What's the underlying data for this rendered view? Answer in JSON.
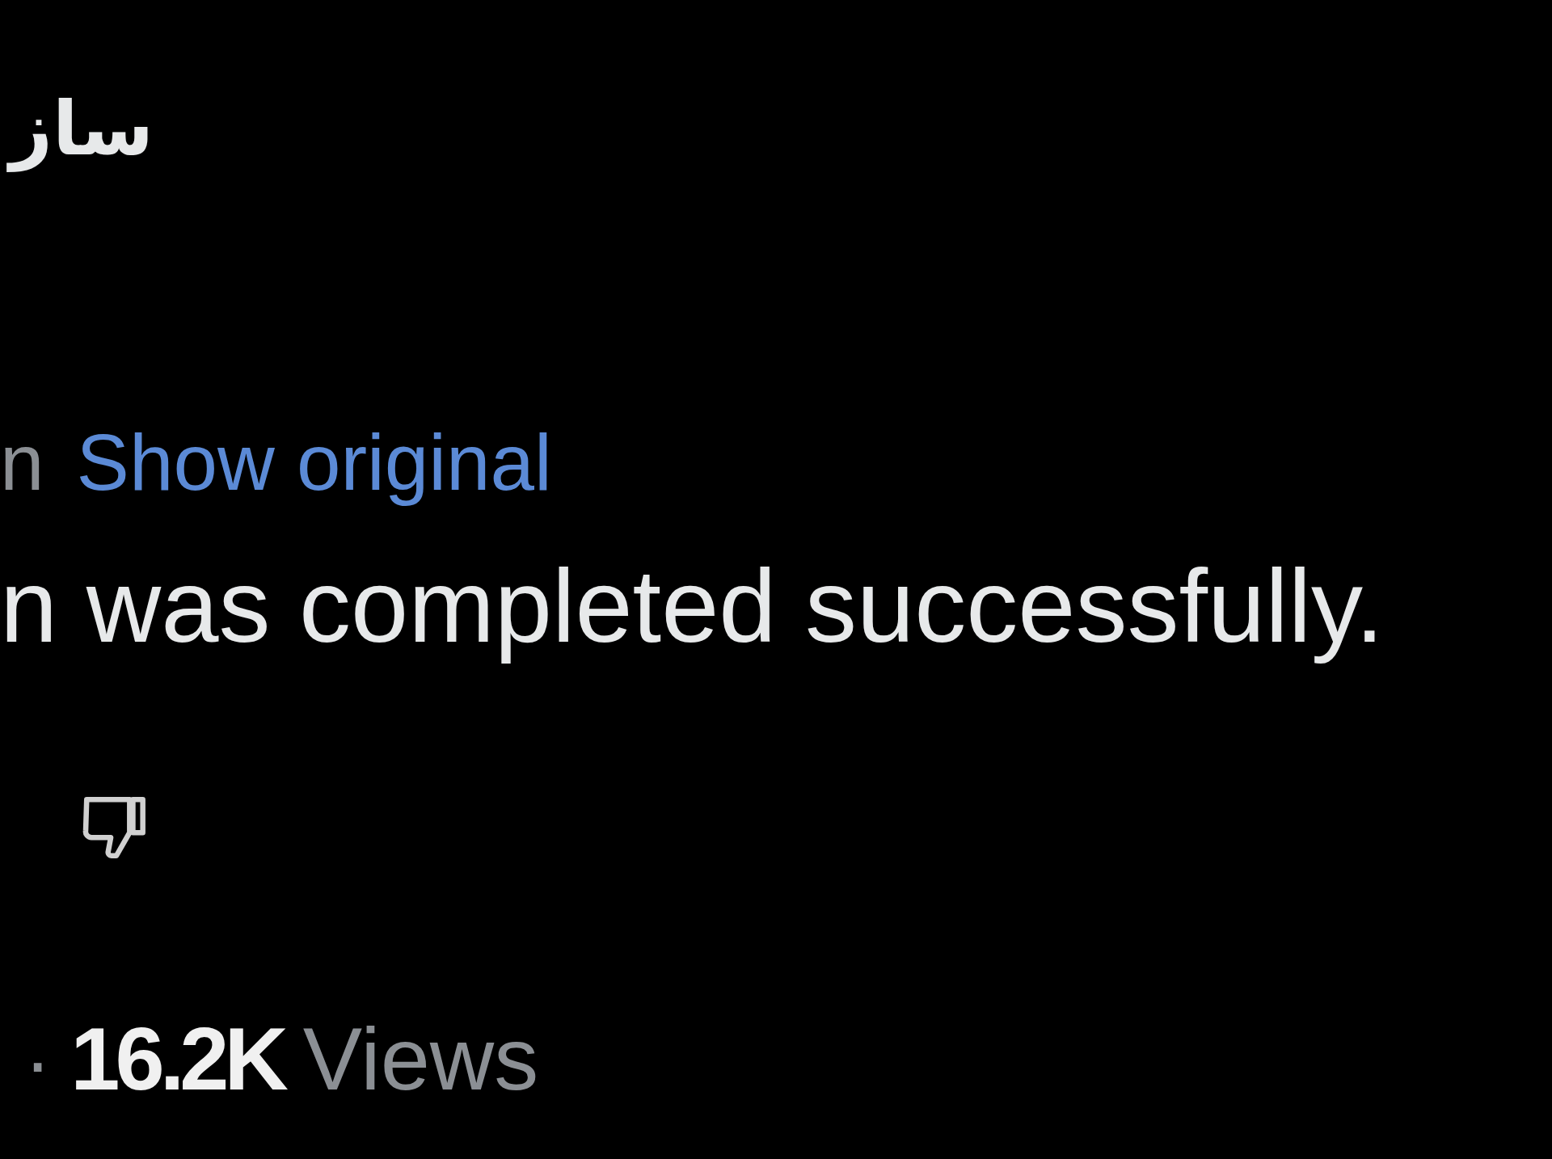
{
  "author_name_fragment": "ساز",
  "translation": {
    "label_fragment": "n",
    "show_original": "Show original"
  },
  "tweet_text": "n was completed successfully.",
  "actions": [
    {
      "kind": "dislike"
    }
  ],
  "meta": {
    "separator": "·",
    "views_count": "16.2K",
    "views_label": "Views"
  }
}
